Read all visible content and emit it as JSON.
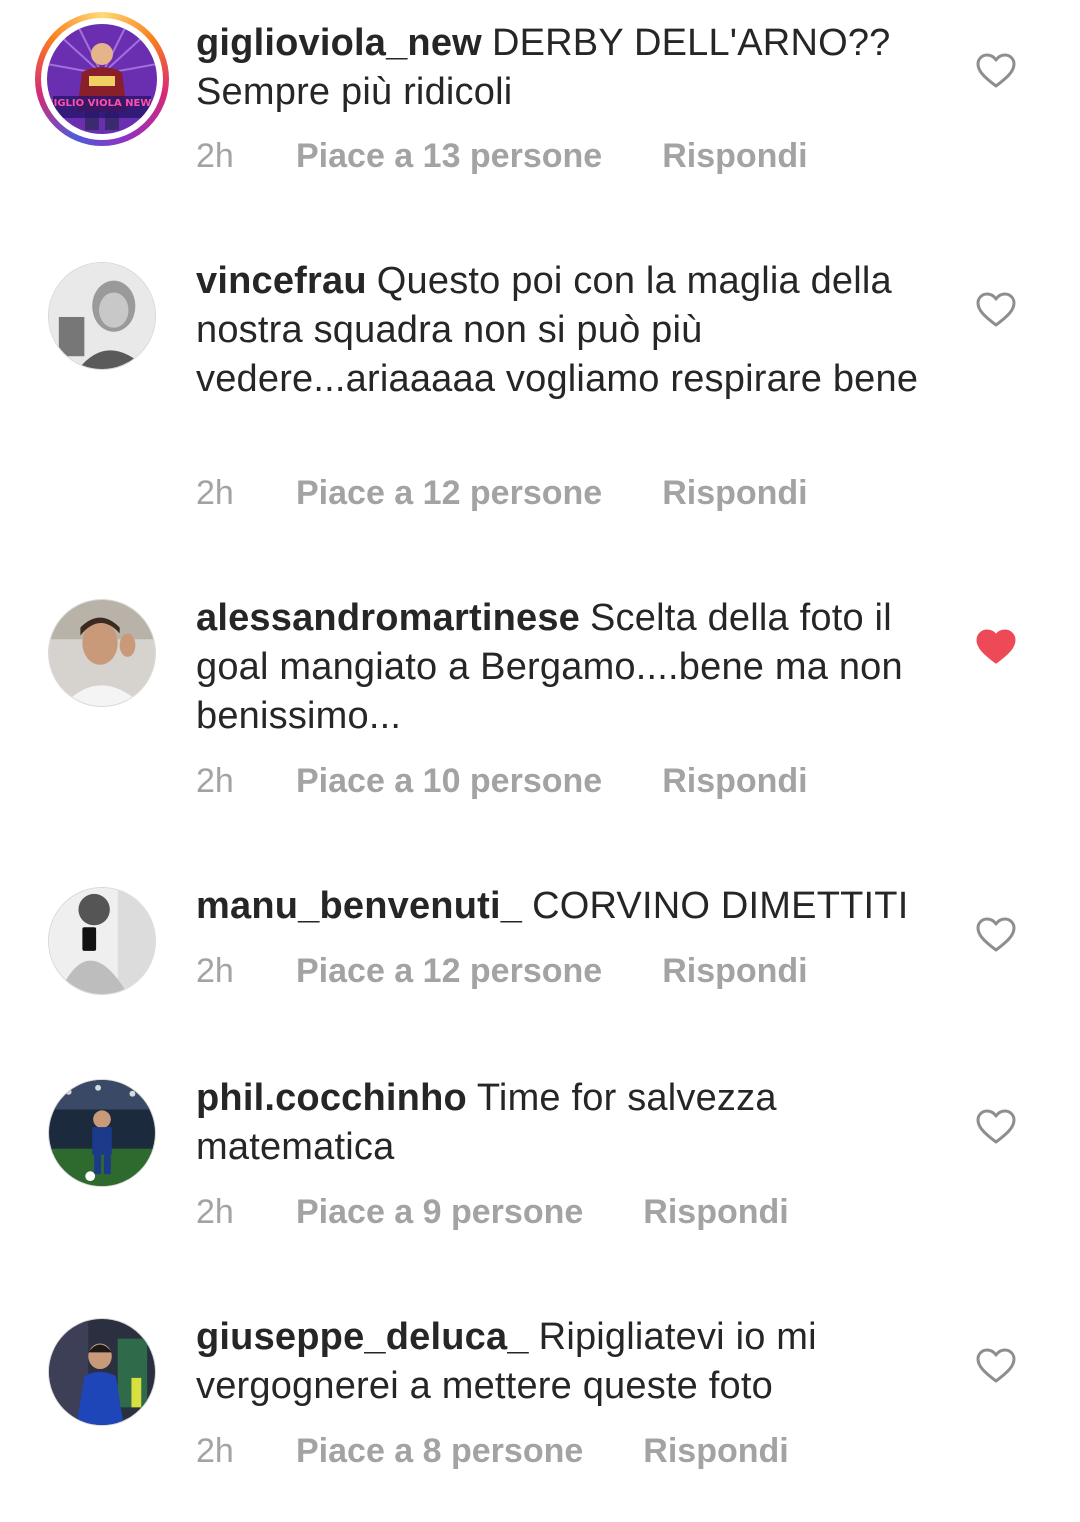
{
  "comments": [
    {
      "username": "giglioviola_new",
      "text": "DERBY DELL'ARNO?? Sempre più ridicoli",
      "time": "2h",
      "likes": "Piace a 13 persone",
      "reply": "Rispondi",
      "liked": false,
      "avatar_icon": "giglio-viola-news-logo-avatar",
      "avatar_text": "GIGLIO VIOLA NEWS"
    },
    {
      "username": "vincefrau",
      "text": "Questo poi con la maglia della nostra squadra non si può più vedere...ariaaaaa vogliamo respirare bene",
      "time": "2h",
      "likes": "Piace a 12 persone",
      "reply": "Rispondi",
      "liked": false,
      "avatar_icon": "user-photo-avatar"
    },
    {
      "username": "alessandromartinese",
      "text": "Scelta della foto il goal mangiato a Bergamo....bene ma non benissimo...",
      "time": "2h",
      "likes": "Piace a 10 persone",
      "reply": "Rispondi",
      "liked": true,
      "avatar_icon": "user-photo-avatar"
    },
    {
      "username": "manu_benvenuti_",
      "text": "CORVINO DIMETTITI",
      "time": "2h",
      "likes": "Piace a 12 persone",
      "reply": "Rispondi",
      "liked": false,
      "avatar_icon": "user-photo-avatar"
    },
    {
      "username": "phil.cocchinho",
      "text": "Time for salvezza matematica",
      "time": "2h",
      "likes": "Piace a 9 persone",
      "reply": "Rispondi",
      "liked": false,
      "avatar_icon": "user-photo-avatar"
    },
    {
      "username": "giuseppe_deluca_",
      "text": "Ripigliatevi io mi vergognerei a mettere queste foto",
      "time": "2h",
      "likes": "Piace a 8 persone",
      "reply": "Rispondi",
      "liked": false,
      "avatar_icon": "user-photo-avatar"
    }
  ],
  "colors": {
    "liked_heart": "#ed4956",
    "heart_outline": "#8e8e8e",
    "meta_text": "#a3a3a3",
    "body_text": "#262626"
  }
}
